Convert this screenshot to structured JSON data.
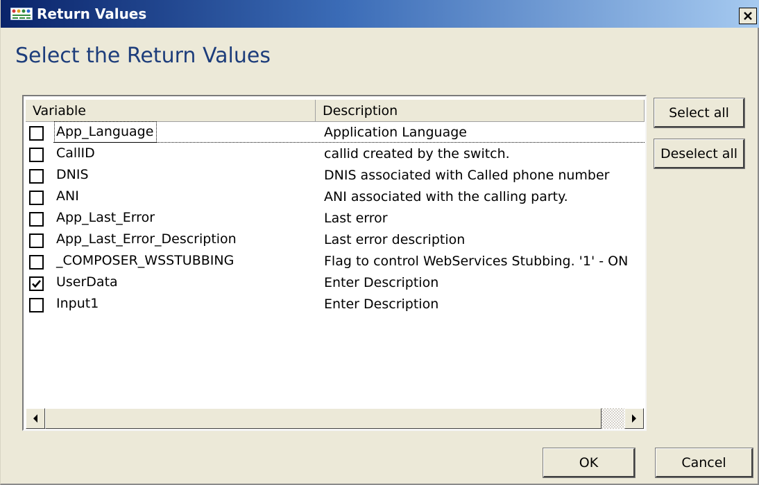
{
  "window": {
    "title": "Return Values",
    "close_label": "×"
  },
  "heading": "Select the Return Values",
  "table": {
    "columns": [
      "Variable",
      "Description"
    ],
    "rows": [
      {
        "variable": "App_Language",
        "description": "Application Language",
        "checked": false
      },
      {
        "variable": "CallID",
        "description": "callid created by the switch.",
        "checked": false
      },
      {
        "variable": "DNIS",
        "description": "DNIS associated with Called phone number",
        "checked": false
      },
      {
        "variable": "ANI",
        "description": "ANI associated with the calling party.",
        "checked": false
      },
      {
        "variable": "App_Last_Error",
        "description": "Last error",
        "checked": false
      },
      {
        "variable": "App_Last_Error_Description",
        "description": "Last error description",
        "checked": false
      },
      {
        "variable": "_COMPOSER_WSSTUBBING",
        "description": "Flag to control WebServices Stubbing. '1' - ON",
        "checked": false
      },
      {
        "variable": "UserData",
        "description": " Enter Description",
        "checked": true
      },
      {
        "variable": "Input1",
        "description": " Enter Description",
        "checked": false
      }
    ]
  },
  "buttons": {
    "select_all": "Select all",
    "deselect_all": "Deselect all",
    "ok": "OK",
    "cancel": "Cancel"
  },
  "icons": {
    "app": "return-values-app-icon",
    "close": "close-icon",
    "check": "checkmark-icon",
    "scroll_left": "arrow-left-icon",
    "scroll_right": "arrow-right-icon"
  },
  "colors": {
    "title_gradient_start": "#0a246a",
    "title_gradient_end": "#a6caf0",
    "heading": "#1d3d7b",
    "dialog_bg": "#ece9d8"
  }
}
